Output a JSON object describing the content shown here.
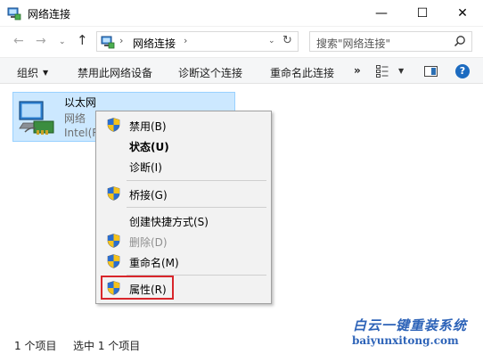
{
  "window": {
    "title": "网络连接",
    "minimize_glyph": "—",
    "maximize_glyph": "☐",
    "close_glyph": "✕"
  },
  "address": {
    "back_glyph": "←",
    "forward_glyph": "→",
    "dropdown_glyph": "⌄",
    "up_glyph": "↑",
    "separator": "›",
    "path": "网络连接",
    "refresh_glyph": "↻",
    "search_placeholder": "搜索\"网络连接\""
  },
  "toolbar": {
    "organize": "组织",
    "organize_caret": "▼",
    "disable_device": "禁用此网络设备",
    "diagnose": "诊断这个连接",
    "rename": "重命名此连接",
    "more": "»",
    "view_caret": "▼",
    "help": "?"
  },
  "connection": {
    "name": "以太网",
    "status": "网络",
    "device": "Intel(R)"
  },
  "context_menu": {
    "items": [
      {
        "label": "禁用(B)",
        "shield": true,
        "bold": false,
        "disabled": false
      },
      {
        "label": "状态(U)",
        "shield": false,
        "bold": true,
        "disabled": false
      },
      {
        "label": "诊断(I)",
        "shield": false,
        "bold": false,
        "disabled": false
      },
      {
        "label": "桥接(G)",
        "shield": true,
        "bold": false,
        "disabled": false
      },
      {
        "label": "创建快捷方式(S)",
        "shield": false,
        "bold": false,
        "disabled": false
      },
      {
        "label": "删除(D)",
        "shield": true,
        "bold": false,
        "disabled": true
      },
      {
        "label": "重命名(M)",
        "shield": true,
        "bold": false,
        "disabled": false
      },
      {
        "label": "属性(R)",
        "shield": true,
        "bold": false,
        "disabled": false,
        "highlighted": true
      }
    ]
  },
  "status": {
    "item_count": "1 个项目",
    "selected": "选中 1 个项目"
  },
  "watermark": {
    "brand": "白云一键重装系统",
    "url": "baiyunxitong.com"
  },
  "colors": {
    "selection_bg": "#cce8ff",
    "highlight_border": "#d8262b",
    "help_blue": "#1c6bc0",
    "watermark_blue": "#2d63b8"
  }
}
